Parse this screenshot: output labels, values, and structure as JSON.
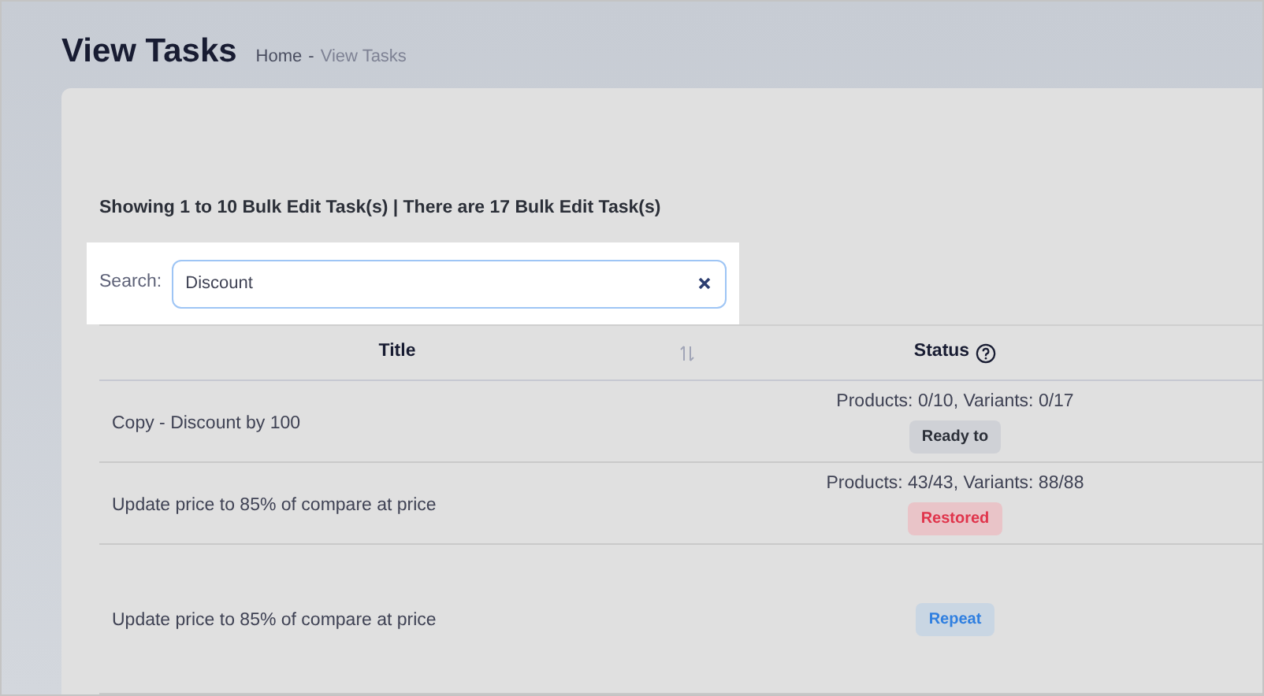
{
  "page_title": "View Tasks",
  "breadcrumb": [
    {
      "label": "Home",
      "current": false
    },
    {
      "label": "-",
      "current": false
    },
    {
      "label": "View Tasks",
      "current": true
    }
  ],
  "summary": "Showing 1 to 10 Bulk Edit Task(s) | There are 17 Bulk Edit Task(s)",
  "search": {
    "label": "Search:",
    "value": "Discount"
  },
  "table": {
    "columns": [
      {
        "label": "Title",
        "sortable": true
      },
      {
        "label": "Status",
        "help": true
      }
    ],
    "rows": [
      {
        "title": "Copy - Discount by 100",
        "progress": "Products: 0/10, Variants: 0/17",
        "badge": {
          "label": "Ready to",
          "kind": "neutral"
        }
      },
      {
        "title": "Update price to 85% of compare at price",
        "progress": "Products: 43/43, Variants: 88/88",
        "badge": {
          "label": "Restored",
          "kind": "danger"
        }
      },
      {
        "title": "Update price to 85% of compare at price",
        "badge": {
          "label": "Repeat",
          "kind": "info"
        }
      }
    ]
  }
}
